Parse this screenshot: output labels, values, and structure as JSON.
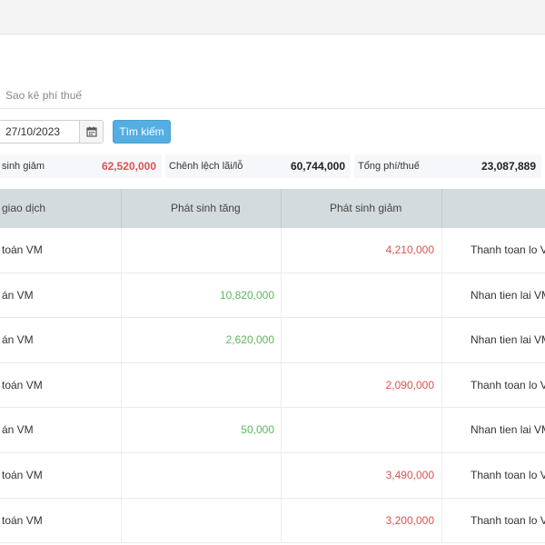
{
  "tabs": {
    "tax_statement": "Sao kê phí thuế"
  },
  "filters": {
    "date_value": "27/10/2023",
    "search_label": "Tìm kiếm"
  },
  "summary": {
    "decrease_label": "sinh giảm",
    "decrease_value": "62,520,000",
    "profit_label": "Chênh lệch lãi/lỗ",
    "profit_value": "60,744,000",
    "fee_label": "Tổng phí/thuế",
    "fee_value": "23,087,889"
  },
  "table": {
    "headers": [
      "giao dịch",
      "Phát sinh tăng",
      "Phát sinh giảm",
      ""
    ],
    "rows": [
      {
        "type": "toán VM",
        "increase": "",
        "decrease": "4,210,000",
        "note": "Thanh toan lo VM"
      },
      {
        "type": "án VM",
        "increase": "10,820,000",
        "decrease": "",
        "note": "Nhan tien lai VM,"
      },
      {
        "type": "án VM",
        "increase": "2,620,000",
        "decrease": "",
        "note": "Nhan tien lai VM,"
      },
      {
        "type": "toán VM",
        "increase": "",
        "decrease": "2,090,000",
        "note": "Thanh toan lo VM"
      },
      {
        "type": "án VM",
        "increase": "50,000",
        "decrease": "",
        "note": "Nhan tien lai VM,"
      },
      {
        "type": "toán VM",
        "increase": "",
        "decrease": "3,490,000",
        "note": "Thanh toan lo VM"
      },
      {
        "type": "toán VM",
        "increase": "",
        "decrease": "3,200,000",
        "note": "Thanh toan lo VM"
      }
    ]
  },
  "colors": {
    "accent": "#55aee2",
    "increase": "#5cb85c",
    "decrease": "#d9534f",
    "header_bg": "#d4dbdf"
  }
}
